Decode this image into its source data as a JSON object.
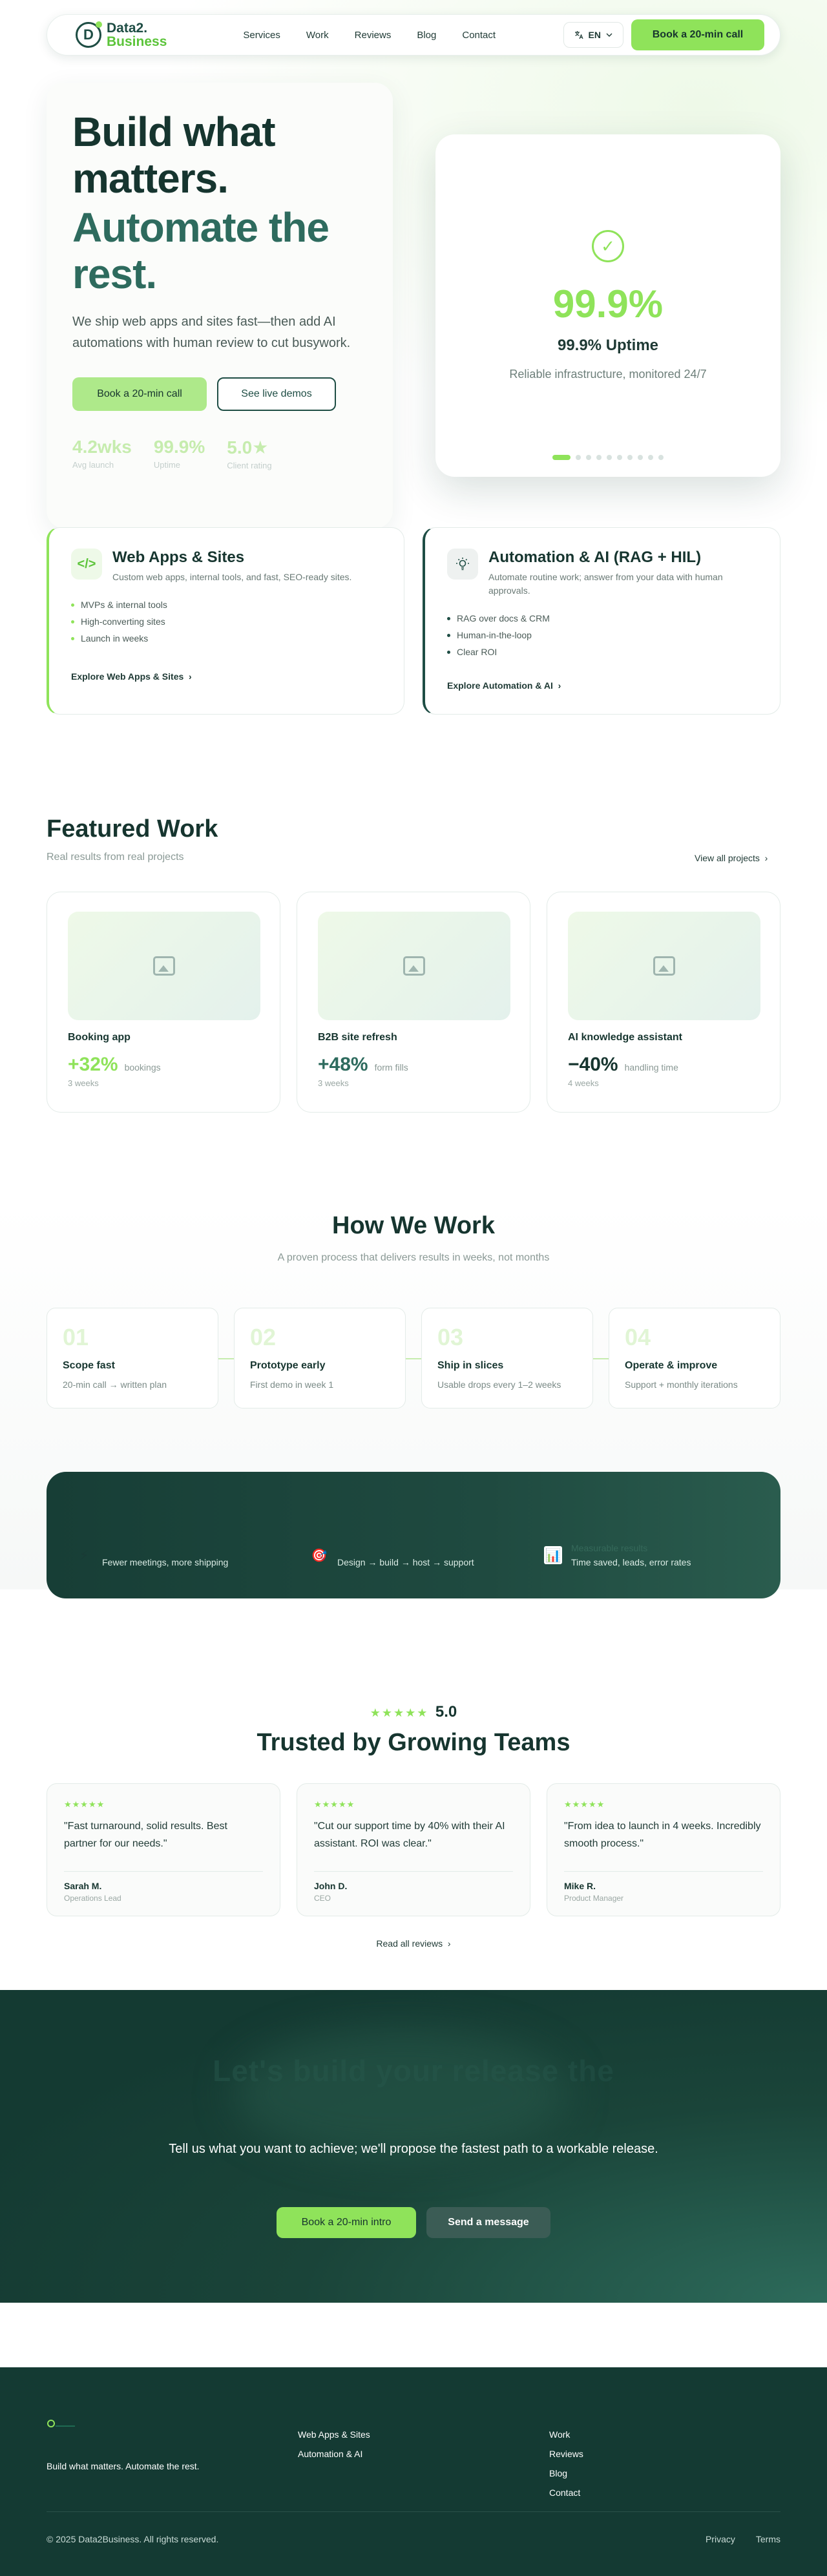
{
  "nav": {
    "logo_letter": "D",
    "logo_line1": "Data2.",
    "logo_line2": "Business",
    "links": [
      "Services",
      "Work",
      "Reviews",
      "Blog",
      "Contact"
    ],
    "lang": "EN",
    "cta": "Book a 20-min call"
  },
  "hero": {
    "title_line1": "Build what matters.",
    "title_line2": "Automate the rest.",
    "subtitle": "We ship web apps and sites fast—then add AI automations with human review to cut busywork.",
    "primary_cta": "Book a 20-min call",
    "secondary_cta": "See live demos",
    "stats": [
      {
        "value": "4.2wks",
        "label": "Avg launch"
      },
      {
        "value": "99.9%",
        "label": "Uptime"
      },
      {
        "value": "5.0★",
        "label": "Client rating"
      }
    ]
  },
  "uptime": {
    "value": "99.9%",
    "title": "99.9% Uptime",
    "subtitle": "Reliable infrastructure, monitored 24/7",
    "slide_count": 10,
    "active_slide": 1
  },
  "services": [
    {
      "icon": "code-icon",
      "title": "Web Apps & Sites",
      "desc": "Custom web apps, internal tools, and fast, SEO-ready sites.",
      "bullets": [
        "MVPs & internal tools",
        "High-converting sites",
        "Launch in weeks"
      ],
      "link": "Explore Web Apps & Sites"
    },
    {
      "icon": "lightbulb-icon",
      "title": "Automation & AI (RAG + HIL)",
      "desc": "Automate routine work; answer from your data with human approvals.",
      "bullets": [
        "RAG over docs & CRM",
        "Human-in-the-loop",
        "Clear ROI"
      ],
      "link": "Explore Automation & AI"
    }
  ],
  "featured": {
    "title": "Featured Work",
    "subtitle": "Real results from real projects",
    "view_all": "View all projects",
    "projects": [
      {
        "name": "Booking app",
        "metric": "+32%",
        "unit": "bookings",
        "time": "3 weeks",
        "color": "#8fe35a"
      },
      {
        "name": "B2B site refresh",
        "metric": "+48%",
        "unit": "form fills",
        "time": "3 weeks",
        "color": "#2e6b5e"
      },
      {
        "name": "AI knowledge assistant",
        "metric": "−40%",
        "unit": "handling time",
        "time": "4 weeks",
        "color": "#16352f"
      }
    ]
  },
  "how": {
    "title": "How We Work",
    "subtitle": "A proven process that delivers results in weeks, not months",
    "steps": [
      {
        "num": "01",
        "title": "Scope fast",
        "desc": "20-min call → written plan"
      },
      {
        "num": "02",
        "title": "Prototype early",
        "desc": "First demo in week 1"
      },
      {
        "num": "03",
        "title": "Ship in slices",
        "desc": "Usable drops every 1–2 weeks"
      },
      {
        "num": "04",
        "title": "Operate & improve",
        "desc": "Support + monthly iterations"
      }
    ],
    "band": [
      {
        "icon": "lightning-icon",
        "glyph": "⚡",
        "text": "Fewer meetings, more shipping",
        "ghost": ""
      },
      {
        "icon": "target-icon",
        "glyph": "🎯",
        "text": "Design → build → host → support",
        "ghost": ""
      },
      {
        "icon": "bar-chart-icon",
        "glyph": "📊",
        "text": "Time saved, leads, error rates",
        "ghost": "Measurable results"
      }
    ]
  },
  "reviews": {
    "stars": "★★★★★",
    "rating": "5.0",
    "title": "Trusted by Growing Teams",
    "items": [
      {
        "stars": "★★★★★",
        "quote": "\"Fast turnaround, solid results. Best partner for our needs.\"",
        "name": "Sarah M.",
        "role": "Operations Lead"
      },
      {
        "stars": "★★★★★",
        "quote": "\"Cut our support time by 40% with their AI assistant. ROI was clear.\"",
        "name": "John D.",
        "role": "CEO"
      },
      {
        "stars": "★★★★★",
        "quote": "\"From idea to launch in 4 weeks. Incredibly smooth process.\"",
        "name": "Mike R.",
        "role": "Product Manager"
      }
    ],
    "read_all": "Read all reviews"
  },
  "cta": {
    "ghost_title": "Let's build your release the",
    "subtitle": "Tell us what you want to achieve; we'll propose the fastest path to a workable release.",
    "primary": "Book a 20-min intro",
    "secondary": "Send a message"
  },
  "footer": {
    "tagline": "Build what matters. Automate the rest.",
    "col1": [
      "Web Apps & Sites",
      "Automation & AI"
    ],
    "col2": [
      "Work",
      "Reviews",
      "Blog",
      "Contact"
    ],
    "copyright": "© 2025 Data2Business. All rights reserved.",
    "legal": [
      "Privacy",
      "Terms"
    ]
  }
}
